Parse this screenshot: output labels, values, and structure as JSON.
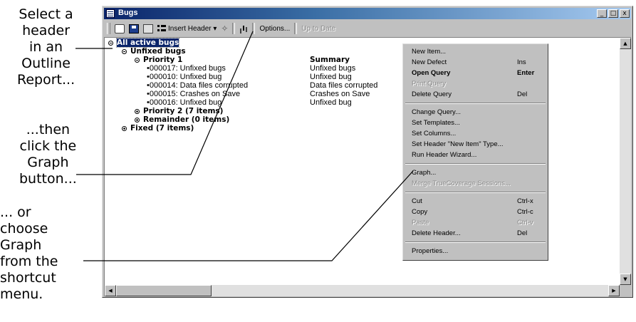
{
  "captions": {
    "step1": "Select a\nheader\nin an\nOutline\nReport...",
    "step2": "...then\nclick the\nGraph\nbutton...",
    "step3": "... or\nchoose\nGraph\nfrom the\nshortcut\nmenu."
  },
  "window": {
    "title": "Bugs",
    "controls": [
      "_",
      "□",
      "x"
    ]
  },
  "toolbar": {
    "insert_header_label": "Insert Header ▾",
    "options_label": "Options...",
    "up_to_date_label": "Up to Date"
  },
  "tree": {
    "root": "All active bugs",
    "groups": {
      "unfixed": "Unfixed bugs",
      "priority1": "Priority 1",
      "priority2": "Priority 2 (7 items)",
      "remainder": "Remainder (0 items)",
      "fixed": "Fixed (7 items)"
    },
    "summary_header": "Summary",
    "items": [
      {
        "label": "000017: Unfixed bugs",
        "summary": "Unfixed bugs"
      },
      {
        "label": "000010: Unfixed bug",
        "summary": "Unfixed bug"
      },
      {
        "label": "000014: Data files corrupted",
        "summary": "Data files corrupted"
      },
      {
        "label": "000015: Crashes on Save",
        "summary": "Crashes on Save"
      },
      {
        "label": "000016: Unfixed bug",
        "summary": "Unfixed bug"
      }
    ]
  },
  "context_menu": {
    "new_item": "New Item...",
    "new_defect": "New Defect",
    "new_defect_key": "Ins",
    "open_query": "Open Query",
    "open_query_key": "Enter",
    "print_query": "Print Query",
    "delete_query": "Delete Query",
    "delete_query_key": "Del",
    "change_query": "Change Query...",
    "set_templates": "Set Templates...",
    "set_columns": "Set Columns...",
    "set_header_type": "Set Header \"New Item\" Type...",
    "run_header_wizard": "Run Header Wizard...",
    "graph": "Graph...",
    "merge_truecoverage": "Merge TrueCoverage Sessions...",
    "cut": "Cut",
    "cut_key": "Ctrl-x",
    "copy": "Copy",
    "copy_key": "Ctrl-c",
    "paste": "Paste",
    "paste_key": "Ctrl-v",
    "delete_header": "Delete Header...",
    "delete_header_key": "Del",
    "properties": "Properties..."
  }
}
